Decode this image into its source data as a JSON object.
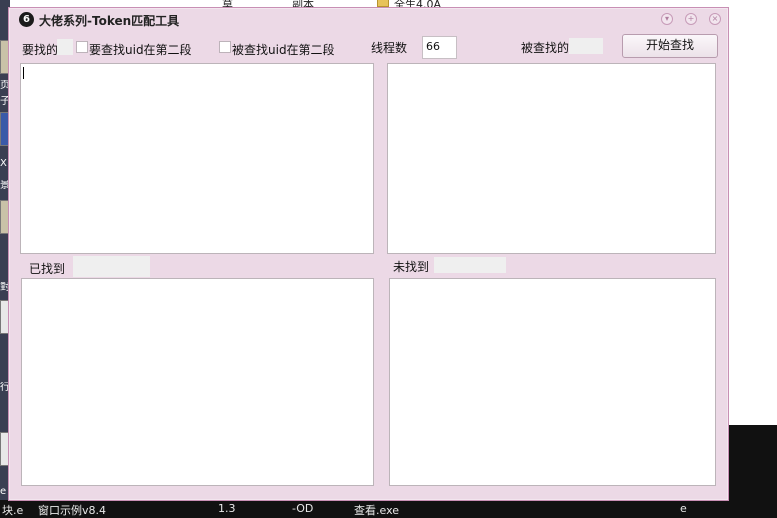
{
  "background": {
    "top_items": [
      "莫",
      "副本"
    ],
    "folder_name": "全生4.0A",
    "left_glyphs": [
      "页",
      "子",
      "X",
      "景",
      "對",
      "行",
      "e"
    ],
    "taskbar": [
      "块.e",
      "窗口示例v8.4",
      "1.3",
      "-OD",
      "查看.exe",
      "e"
    ]
  },
  "window": {
    "logo_glyph": "6",
    "title": "大佬系列-Token匹配工具",
    "controls": {
      "minimize_icon": "chevron-down-icon",
      "maximize_icon": "plus-circle-icon",
      "close_icon": "close-icon"
    }
  },
  "toolbar": {
    "to_find_label": "要找的",
    "to_find_value": "",
    "checkbox_uid_second_find": {
      "label": "要查找uid在第二段",
      "checked": false
    },
    "checkbox_uid_second_searched": {
      "label": "被查找uid在第二段",
      "checked": false
    },
    "threads_label": "线程数",
    "threads_value": "66",
    "searched_label": "被查找的",
    "searched_value": "",
    "start_button": "开始查找"
  },
  "found": {
    "label": "已找到",
    "count": ""
  },
  "not_found": {
    "label": "未找到",
    "count": ""
  },
  "text_areas": {
    "find_text": "",
    "searched_text": "",
    "found_text": "",
    "not_found_text": ""
  }
}
